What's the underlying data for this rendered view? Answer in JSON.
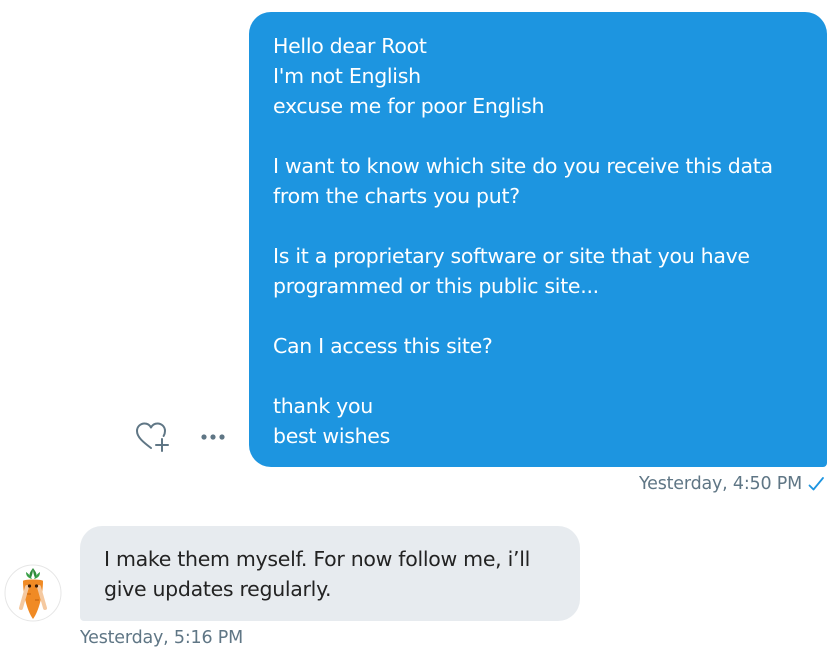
{
  "sent_message": {
    "lines": [
      "Hello dear Root",
      "I'm not English",
      "excuse me for poor English",
      "",
      "I want to know which site do you receive this data",
      "from the charts you put?",
      "",
      "Is it a proprietary software or site that you have",
      "programmed or this public site...",
      "",
      "Can I access this site?",
      "",
      "thank you",
      "best wishes"
    ],
    "timestamp": "Yesterday, 4:50 PM",
    "status_icon": "check-icon",
    "bubble_color": "#1d95e0"
  },
  "message_actions": {
    "like_icon": "heart-plus-icon",
    "more_icon": "more-horizontal-icon"
  },
  "received_message": {
    "lines": [
      "I make them myself. For now follow me, i’ll",
      "give updates regularly."
    ],
    "timestamp": "Yesterday, 5:16 PM",
    "avatar_icon": "carrot-avatar",
    "bubble_color": "#e7ebef"
  },
  "colors": {
    "meta_text": "#5f7685",
    "accent": "#1d95e0"
  }
}
